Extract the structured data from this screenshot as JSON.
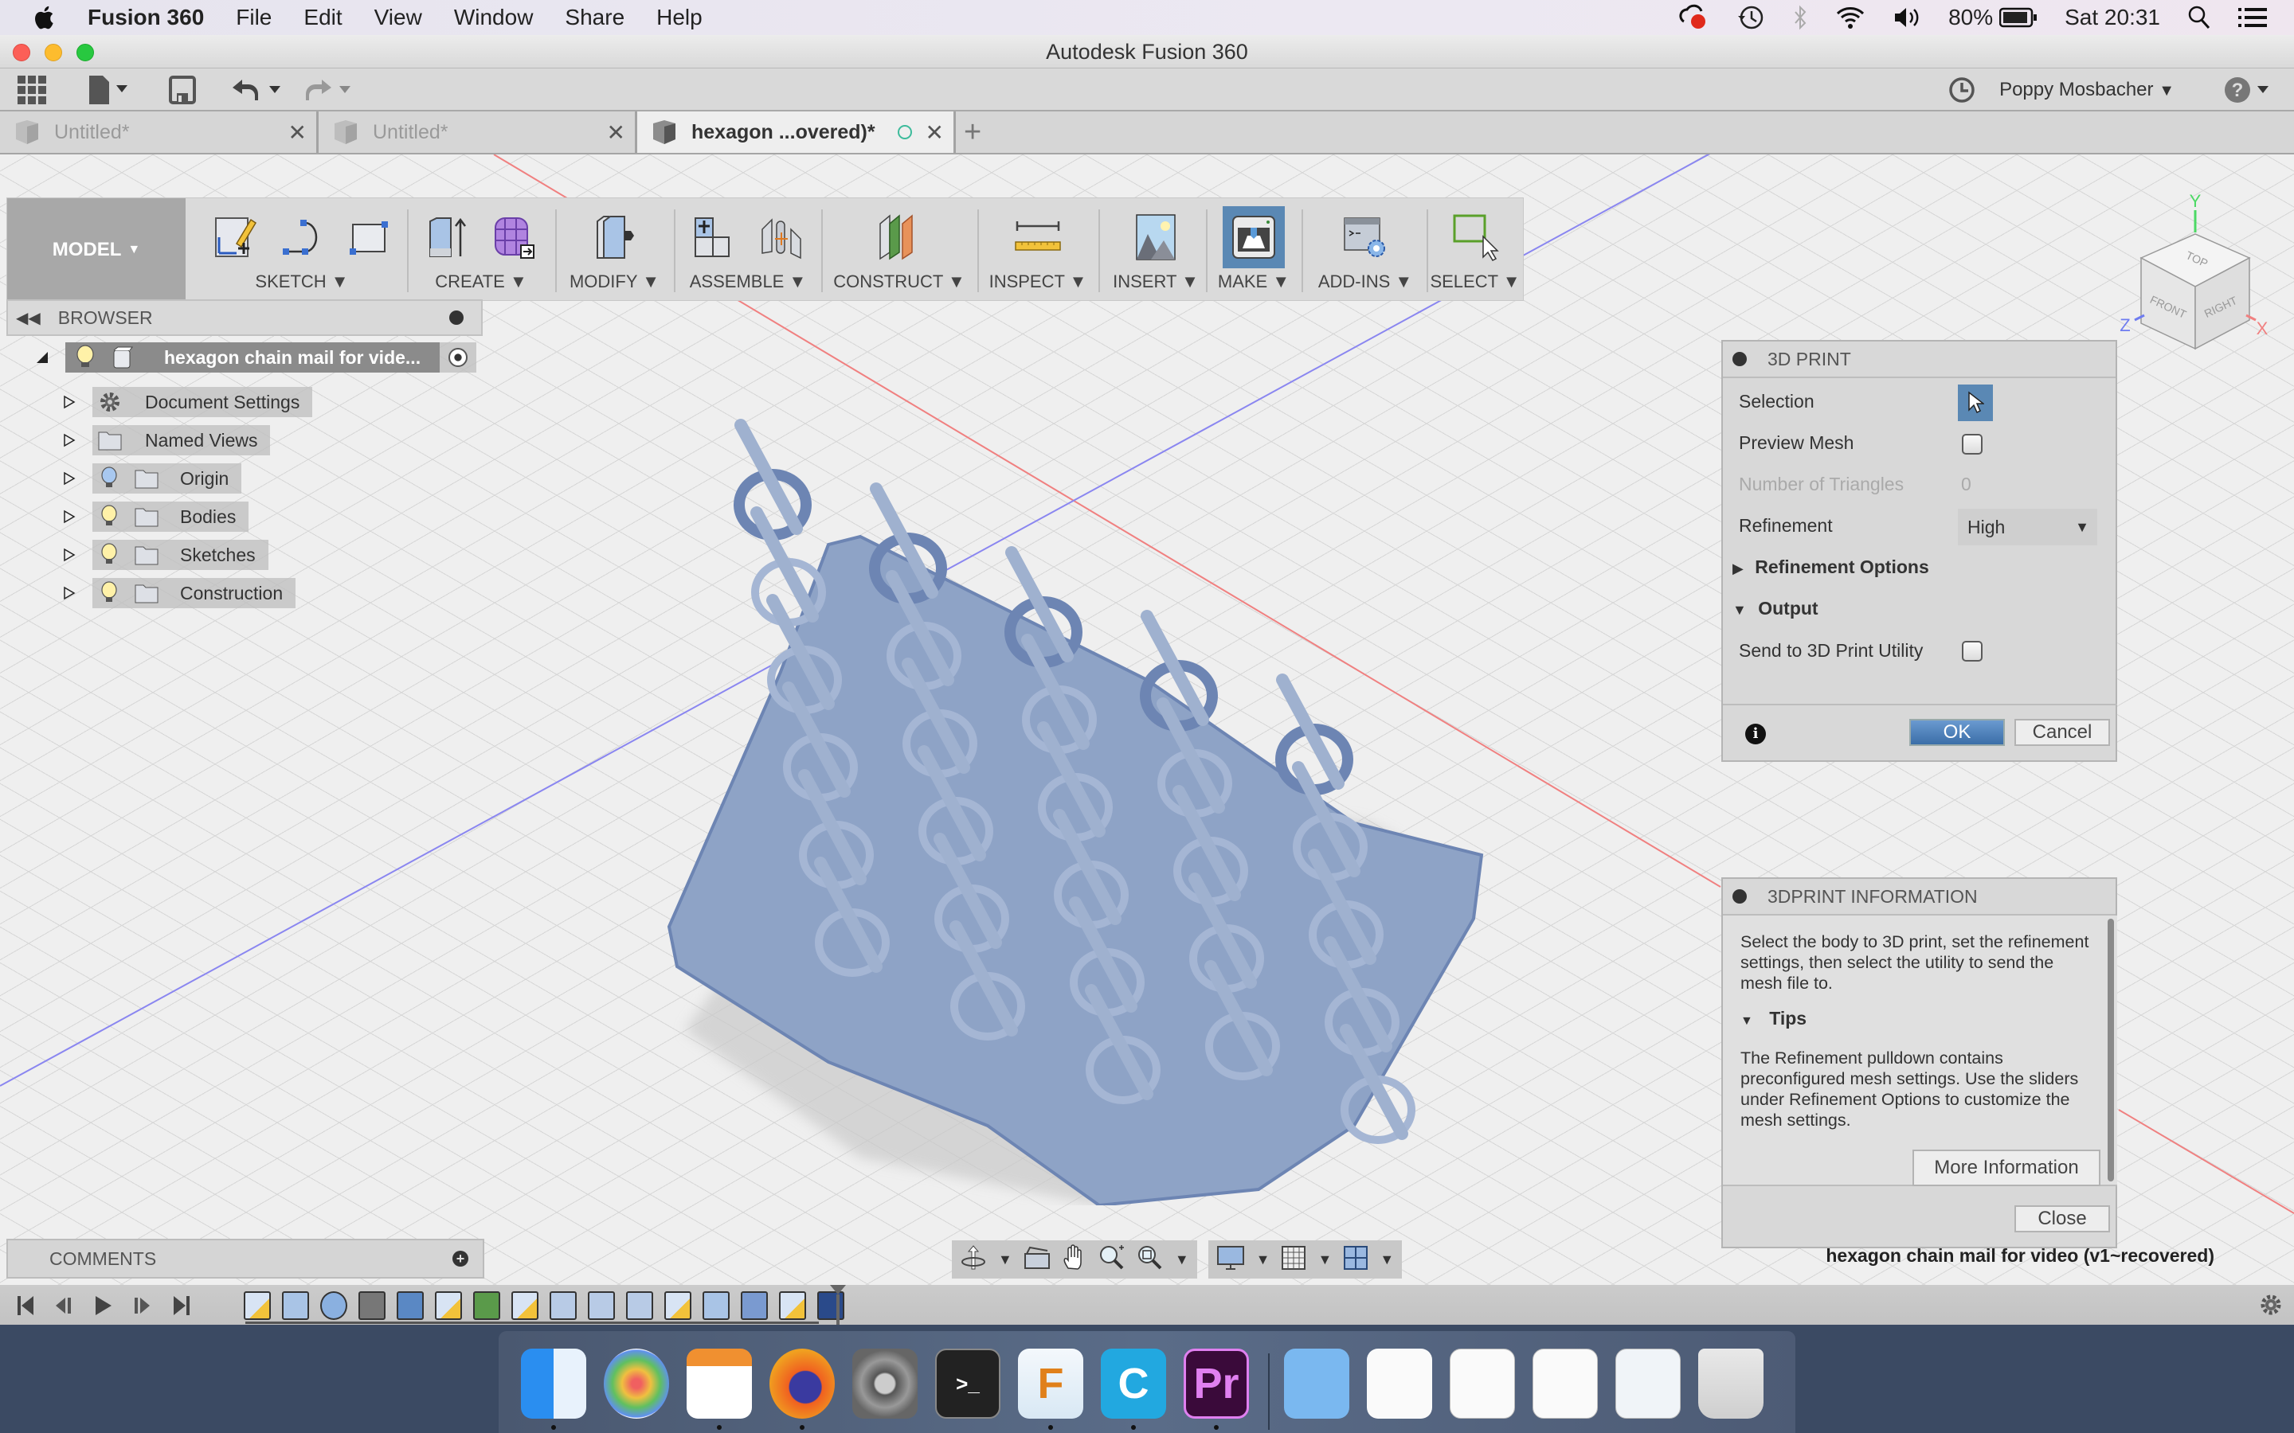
{
  "menubar": {
    "app_name": "Fusion 360",
    "menus": [
      "File",
      "Edit",
      "View",
      "Window",
      "Share",
      "Help"
    ],
    "status": {
      "battery": "80%",
      "clock": "Sat 20:31"
    },
    "icons": [
      "creative-cloud-icon",
      "time-machine-icon",
      "bluetooth-icon",
      "wifi-icon",
      "volume-icon",
      "battery-icon",
      "spotlight-search-icon",
      "notification-center-icon"
    ]
  },
  "window": {
    "title": "Autodesk Fusion 360"
  },
  "quick_access": {
    "user_name": "Poppy Mosbacher",
    "icons": [
      "data-panel-icon",
      "file-icon",
      "save-icon",
      "undo-icon",
      "redo-icon",
      "job-status-icon",
      "help-icon"
    ]
  },
  "tabs": [
    {
      "label": "Untitled*",
      "active": false
    },
    {
      "label": "Untitled*",
      "active": false
    },
    {
      "label": "hexagon ...overed)*",
      "active": true
    }
  ],
  "ribbon": {
    "workspace": "MODEL",
    "groups": [
      {
        "label": "SKETCH",
        "icons": [
          "create-sketch-icon",
          "arc-icon",
          "rectangle-icon"
        ]
      },
      {
        "label": "CREATE",
        "icons": [
          "extrude-icon",
          "create-form-icon"
        ]
      },
      {
        "label": "MODIFY",
        "icons": [
          "press-pull-icon"
        ]
      },
      {
        "label": "ASSEMBLE",
        "icons": [
          "new-component-icon",
          "joint-icon"
        ]
      },
      {
        "label": "CONSTRUCT",
        "icons": [
          "offset-plane-icon"
        ]
      },
      {
        "label": "INSPECT",
        "icons": [
          "measure-icon"
        ]
      },
      {
        "label": "INSERT",
        "icons": [
          "insert-image-icon"
        ]
      },
      {
        "label": "MAKE",
        "icons": [
          "3d-print-icon"
        ]
      },
      {
        "label": "ADD-INS",
        "icons": [
          "scripts-addins-icon"
        ]
      },
      {
        "label": "SELECT",
        "icons": [
          "select-icon"
        ]
      }
    ]
  },
  "browser": {
    "title": "BROWSER",
    "root": "hexagon chain mail for vide...",
    "items": [
      {
        "label": "Document Settings",
        "icon": "gear-icon",
        "visibility": false
      },
      {
        "label": "Named Views",
        "icon": "folder-icon",
        "visibility": false
      },
      {
        "label": "Origin",
        "icon": "folder-icon",
        "visibility": true,
        "bulb": "off"
      },
      {
        "label": "Bodies",
        "icon": "folder-icon",
        "visibility": true,
        "bulb": "on"
      },
      {
        "label": "Sketches",
        "icon": "folder-icon",
        "visibility": true,
        "bulb": "on"
      },
      {
        "label": "Construction",
        "icon": "folder-icon",
        "visibility": true,
        "bulb": "on"
      }
    ]
  },
  "print_dialog": {
    "title": "3D PRINT",
    "selection_label": "Selection",
    "preview_mesh_label": "Preview Mesh",
    "preview_mesh_checked": false,
    "triangles_label": "Number of Triangles",
    "triangles_value": "0",
    "refinement_label": "Refinement",
    "refinement_value": "High",
    "refinement_options_label": "Refinement Options",
    "output_label": "Output",
    "send_utility_label": "Send to 3D Print Utility",
    "send_utility_checked": false,
    "ok_label": "OK",
    "cancel_label": "Cancel"
  },
  "info_panel": {
    "title": "3DPRINT INFORMATION",
    "description": "Select the body to 3D print, set the refinement settings, then select the utility to send the mesh file to.",
    "tips_label": "Tips",
    "tips_text": "The Refinement pulldown contains preconfigured mesh settings. Use the sliders under Refinement Options to customize the mesh settings.",
    "more_info_label": "More Information",
    "close_label": "Close"
  },
  "viewcube": {
    "faces": [
      "TOP",
      "FRONT",
      "RIGHT"
    ],
    "axes": [
      "Y",
      "Z",
      "X"
    ]
  },
  "comments": {
    "title": "COMMENTS"
  },
  "document_name": "hexagon chain mail for video (v1~recovered)",
  "timeline": {
    "feature_count": 17,
    "features": [
      "sketch",
      "extrude",
      "torus",
      "move",
      "pattern",
      "sketch",
      "plane",
      "sketch",
      "shell",
      "shell",
      "shell",
      "sketch",
      "extrude",
      "combine",
      "sketch",
      "rectangular-pattern"
    ]
  },
  "dock": {
    "apps": [
      {
        "name": "Finder",
        "running": true
      },
      {
        "name": "Photos",
        "running": false
      },
      {
        "name": "Pages",
        "running": true
      },
      {
        "name": "Firefox",
        "running": true
      },
      {
        "name": "System Preferences",
        "running": false
      },
      {
        "name": "Terminal",
        "running": false
      },
      {
        "name": "Fusion 360",
        "running": true
      },
      {
        "name": "Camtasia",
        "running": true
      },
      {
        "name": "Premiere Pro",
        "running": true
      },
      {
        "name": "Applications",
        "running": false
      },
      {
        "name": "Document",
        "running": false
      },
      {
        "name": "Pages Document 1",
        "running": false
      },
      {
        "name": "Pages Document 2",
        "running": false
      },
      {
        "name": "Finder Window",
        "running": false
      },
      {
        "name": "Trash",
        "running": false
      }
    ]
  },
  "colors": {
    "model_body": "#8ea3c6",
    "model_edge": "#6d85b3",
    "accent_blue": "#5a88b4",
    "x_axis": "#f08080",
    "y_axis": "#4cd964",
    "z_axis": "#6e7cf0"
  }
}
